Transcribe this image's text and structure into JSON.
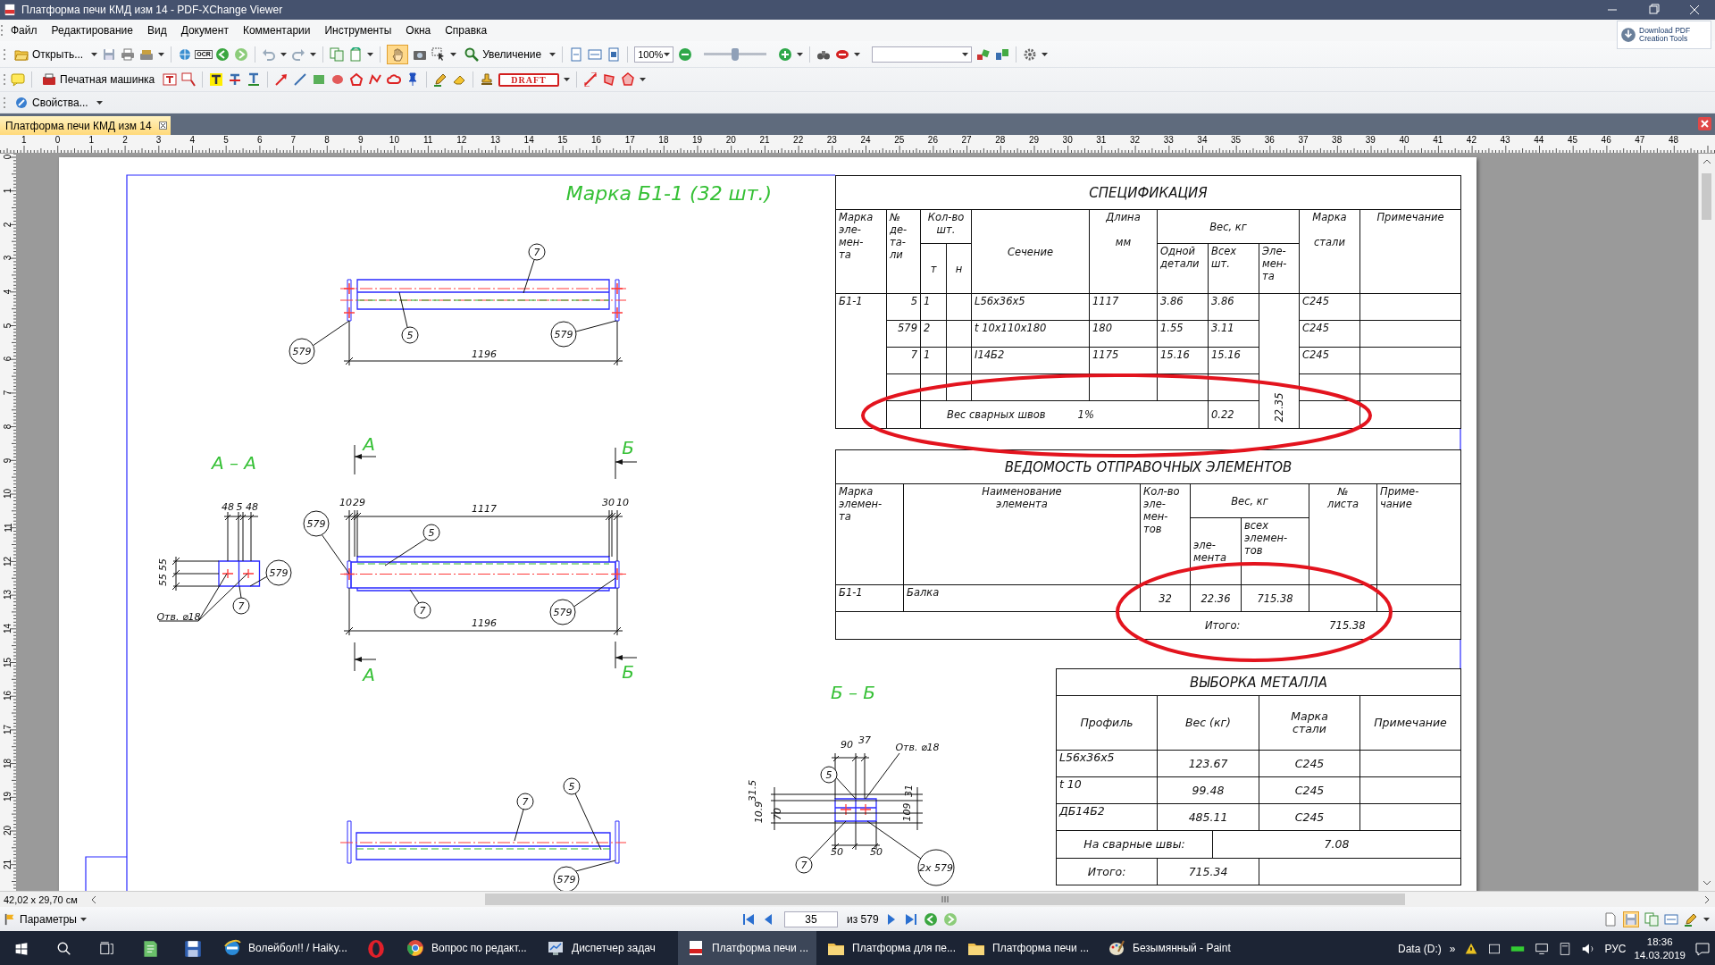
{
  "window": {
    "title": "Платформа печи КМД изм 14 - PDF-XChange Viewer"
  },
  "menu": [
    "Файл",
    "Редактирование",
    "Вид",
    "Документ",
    "Комментарии",
    "Инструменты",
    "Окна",
    "Справка"
  ],
  "promo_button": {
    "label": "Download PDF\nCreation Tools"
  },
  "toolbar_1": {
    "open_label": "Открыть...",
    "ocr_label": "OCR",
    "hand_tool": {
      "selected": true
    },
    "zoom_label": "Увеличение",
    "zoom_value": "100%",
    "zoom_slider": {
      "level": 0.5
    }
  },
  "toolbar_2": {
    "typewriter_label": "Печатная машинка",
    "stamp_label": "DRAFT"
  },
  "toolbar_3": {
    "properties_label": "Свойства..."
  },
  "tabs": [
    {
      "label": "Платформа печи КМД изм 14",
      "selected": true
    }
  ],
  "ruler": {
    "horizontal": [
      "1",
      "0",
      "1",
      "2",
      "3",
      "4",
      "5",
      "6",
      "7",
      "8",
      "9",
      "10",
      "11",
      "12",
      "13",
      "14",
      "15",
      "16",
      "17",
      "18",
      "19",
      "20",
      "21",
      "22",
      "23",
      "24",
      "25",
      "26",
      "27",
      "28",
      "29",
      "30",
      "31",
      "32",
      "33",
      "34",
      "35",
      "36",
      "37",
      "38",
      "39",
      "40",
      "41",
      "42",
      "43",
      "44",
      "45",
      "46",
      "47",
      "48"
    ],
    "vertical": [
      "0",
      "1",
      "2",
      "3",
      "4",
      "5",
      "6",
      "7",
      "8",
      "9",
      "10",
      "11",
      "12",
      "13",
      "14",
      "15",
      "16",
      "17",
      "18",
      "19",
      "20",
      "21"
    ]
  },
  "drawing": {
    "title": "Марка Б1-1 (32 шт.)",
    "labels": [
      {
        "kind": "balloon",
        "text": "7"
      },
      {
        "kind": "balloon",
        "text": "5"
      },
      {
        "kind": "balloon",
        "text": "579"
      },
      {
        "kind": "balloon",
        "text": "579"
      },
      {
        "kind": "dimension",
        "text": "1196"
      },
      {
        "kind": "section",
        "text": "А"
      },
      {
        "kind": "section",
        "text": "Б"
      },
      {
        "kind": "section",
        "text": "А – А"
      },
      {
        "kind": "dimension",
        "text": "48"
      },
      {
        "kind": "dimension",
        "text": "5"
      },
      {
        "kind": "dimension",
        "text": "48"
      },
      {
        "kind": "dimension",
        "text": "10"
      },
      {
        "kind": "dimension",
        "text": "29"
      },
      {
        "kind": "dimension",
        "text": "1117"
      },
      {
        "kind": "dimension",
        "text": "30"
      },
      {
        "kind": "dimension",
        "text": "10"
      },
      {
        "kind": "balloon",
        "text": "579"
      },
      {
        "kind": "balloon",
        "text": "5"
      },
      {
        "kind": "vertical_dimension",
        "text": "55"
      },
      {
        "kind": "vertical_dimension",
        "text": "55"
      },
      {
        "kind": "balloon",
        "text": "579"
      },
      {
        "kind": "balloon",
        "text": "7"
      },
      {
        "kind": "note",
        "text": "Отв. ⌀18"
      },
      {
        "kind": "balloon",
        "text": "7"
      },
      {
        "kind": "balloon",
        "text": "579"
      },
      {
        "kind": "dimension",
        "text": "1196"
      },
      {
        "kind": "section",
        "text": "А"
      },
      {
        "kind": "section",
        "text": "Б"
      },
      {
        "kind": "section",
        "text": "Б – Б"
      },
      {
        "kind": "dimension",
        "text": "90"
      },
      {
        "kind": "dimension",
        "text": "37"
      },
      {
        "kind": "note",
        "text": "Отв. ⌀18"
      },
      {
        "kind": "balloon",
        "text": "5"
      },
      {
        "kind": "vertical_dimension",
        "text": "31.5"
      },
      {
        "kind": "vertical_dimension",
        "text": "10.9"
      },
      {
        "kind": "vertical_dimension",
        "text": "70"
      },
      {
        "kind": "vertical_dimension",
        "text": "31"
      },
      {
        "kind": "vertical_dimension",
        "text": "109"
      },
      {
        "kind": "dimension",
        "text": "50"
      },
      {
        "kind": "dimension",
        "text": "50"
      },
      {
        "kind": "balloon",
        "text": "7"
      },
      {
        "kind": "balloon",
        "text": "2х 579"
      },
      {
        "kind": "balloon",
        "text": "7"
      },
      {
        "kind": "balloon",
        "text": "5"
      },
      {
        "kind": "balloon",
        "text": "579"
      }
    ]
  },
  "specification": {
    "title": "СПЕЦИФИКАЦИЯ",
    "headers": [
      "Марка\nэле-\nмен-\nта",
      "№\nде-\nта-\nли",
      "Кол-во\nшт.",
      "Сечение",
      "Длина\n\nмм",
      "Вес, кг",
      "Марка\n\nстали",
      "Примечание",
      "т",
      "н",
      "Одной\nдетали",
      "Всех\nшт.",
      "Эле-\nмен-\nта"
    ],
    "element_mark": "Б1-1",
    "rows": [
      {
        "part": "5",
        "qty_t": "1",
        "section": "L56x36x5",
        "length": "1117",
        "weight_one": "3.86",
        "weight_all": "3.86",
        "steel": "С245"
      },
      {
        "part": "579",
        "qty_t": "2",
        "section": "t 10x110x180",
        "length": "180",
        "weight_one": "1.55",
        "weight_all": "3.11",
        "steel": "С245"
      },
      {
        "part": "7",
        "qty_t": "1",
        "section": "I14Б2",
        "length": "1175",
        "weight_one": "15.16",
        "weight_all": "15.16",
        "steel": "С245"
      }
    ],
    "weld": {
      "label": "Вес сварных швов",
      "percent": "1%",
      "weight": "0.22"
    },
    "element_weight": "22.35"
  },
  "shipping_list": {
    "title": "ВЕДОМОСТЬ ОТПРАВОЧНЫХ ЭЛЕМЕНТОВ",
    "headers": [
      "Марка\nэлемен-\nта",
      "Наименование\nэлемента",
      "Кол-во\nэле-\nмен-\nтов",
      "Вес, кг",
      "№\nлиста",
      "Приме-\nчание",
      "эле-\nмента",
      "всех\nэлемен-\nтов"
    ],
    "rows": [
      {
        "mark": "Б1-1",
        "name": "Балка",
        "qty": "32",
        "weight_one": "22.36",
        "weight_all": "715.38"
      }
    ],
    "total_label": "Итого:",
    "total": "715.38"
  },
  "metal_takeoff": {
    "title": "ВЫБОРКА МЕТАЛЛА",
    "headers": [
      "Профиль",
      "Вес (кг)",
      "Марка\nстали",
      "Примечание"
    ],
    "rows": [
      {
        "profile": "L56x36x5",
        "weight": "123.67",
        "steel": "С245"
      },
      {
        "profile": "t 10",
        "weight": "99.48",
        "steel": "С245"
      },
      {
        "profile": "ДБ14Б2",
        "weight": "485.11",
        "steel": "С245"
      }
    ],
    "weld_label": "На сварные швы:",
    "weld": "7.08",
    "total_label": "Итого:",
    "total": "715.34"
  },
  "markups": [
    {
      "kind": "ellipse"
    },
    {
      "kind": "ellipse"
    }
  ],
  "status": {
    "page_size": "42,02 x 29,70 см",
    "options_label": "Параметры",
    "page_field": "35",
    "page_count": "из 579"
  },
  "taskbar": {
    "items": [
      {
        "kind": "pinned",
        "selected": false
      },
      {
        "kind": "pinned",
        "selected": false
      },
      {
        "kind": "window",
        "label": "Волейбол!! / Haiky...",
        "selected": false
      },
      {
        "kind": "pinned",
        "selected": false
      },
      {
        "kind": "window",
        "label": "Вопрос по редакт...",
        "selected": false
      },
      {
        "kind": "window",
        "label": "Диспетчер задач",
        "selected": false
      },
      {
        "kind": "window",
        "label": "Платформа печи ...",
        "selected": true
      },
      {
        "kind": "window",
        "label": "Платформа для пе...",
        "selected": false
      },
      {
        "kind": "window",
        "label": "Платформа печи ...",
        "selected": false
      },
      {
        "kind": "window",
        "label": "Безымянный - Paint",
        "selected": false
      }
    ],
    "tray": {
      "drive": "Data (D:)",
      "overflow": "»",
      "language": "РУС",
      "time": "18:36",
      "date": "14.03.2019"
    }
  }
}
